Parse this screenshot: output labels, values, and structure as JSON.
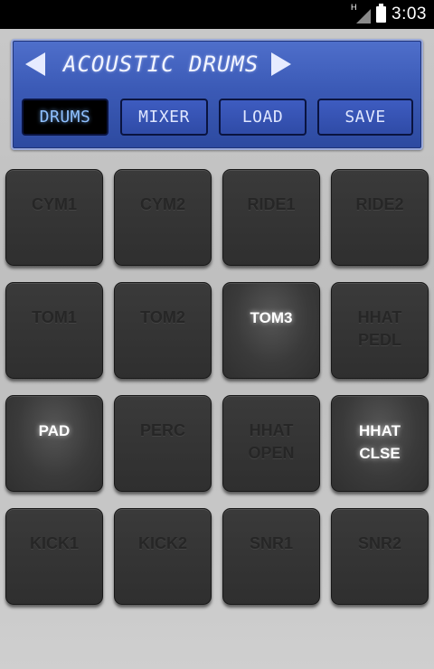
{
  "status_bar": {
    "network_indicator": "H",
    "time": "3:03"
  },
  "header": {
    "kit_name": "ACOUSTIC DRUMS",
    "prev_icon": "left-triangle-arrow",
    "next_icon": "right-triangle-arrow",
    "tabs": [
      {
        "label": "DRUMS",
        "active": true
      },
      {
        "label": "MIXER",
        "active": false
      },
      {
        "label": "LOAD",
        "active": false
      },
      {
        "label": "SAVE",
        "active": false
      }
    ]
  },
  "pads": [
    {
      "label": "CYM1",
      "lit": false
    },
    {
      "label": "CYM2",
      "lit": false
    },
    {
      "label": "RIDE1",
      "lit": false
    },
    {
      "label": "RIDE2",
      "lit": false
    },
    {
      "label": "TOM1",
      "lit": false
    },
    {
      "label": "TOM2",
      "lit": false
    },
    {
      "label": "TOM3",
      "lit": true
    },
    {
      "label": "HHAT\nPEDL",
      "lit": false
    },
    {
      "label": "PAD",
      "lit": true
    },
    {
      "label": "PERC",
      "lit": false
    },
    {
      "label": "HHAT\nOPEN",
      "lit": false
    },
    {
      "label": "HHAT\nCLSE",
      "lit": true
    },
    {
      "label": "KICK1",
      "lit": false
    },
    {
      "label": "KICK2",
      "lit": false
    },
    {
      "label": "SNR1",
      "lit": false
    },
    {
      "label": "SNR2",
      "lit": false
    }
  ],
  "colors": {
    "panel_blue": "#3b5ab6",
    "pad_dark": "#333333",
    "lit_label": "#ffffff"
  }
}
